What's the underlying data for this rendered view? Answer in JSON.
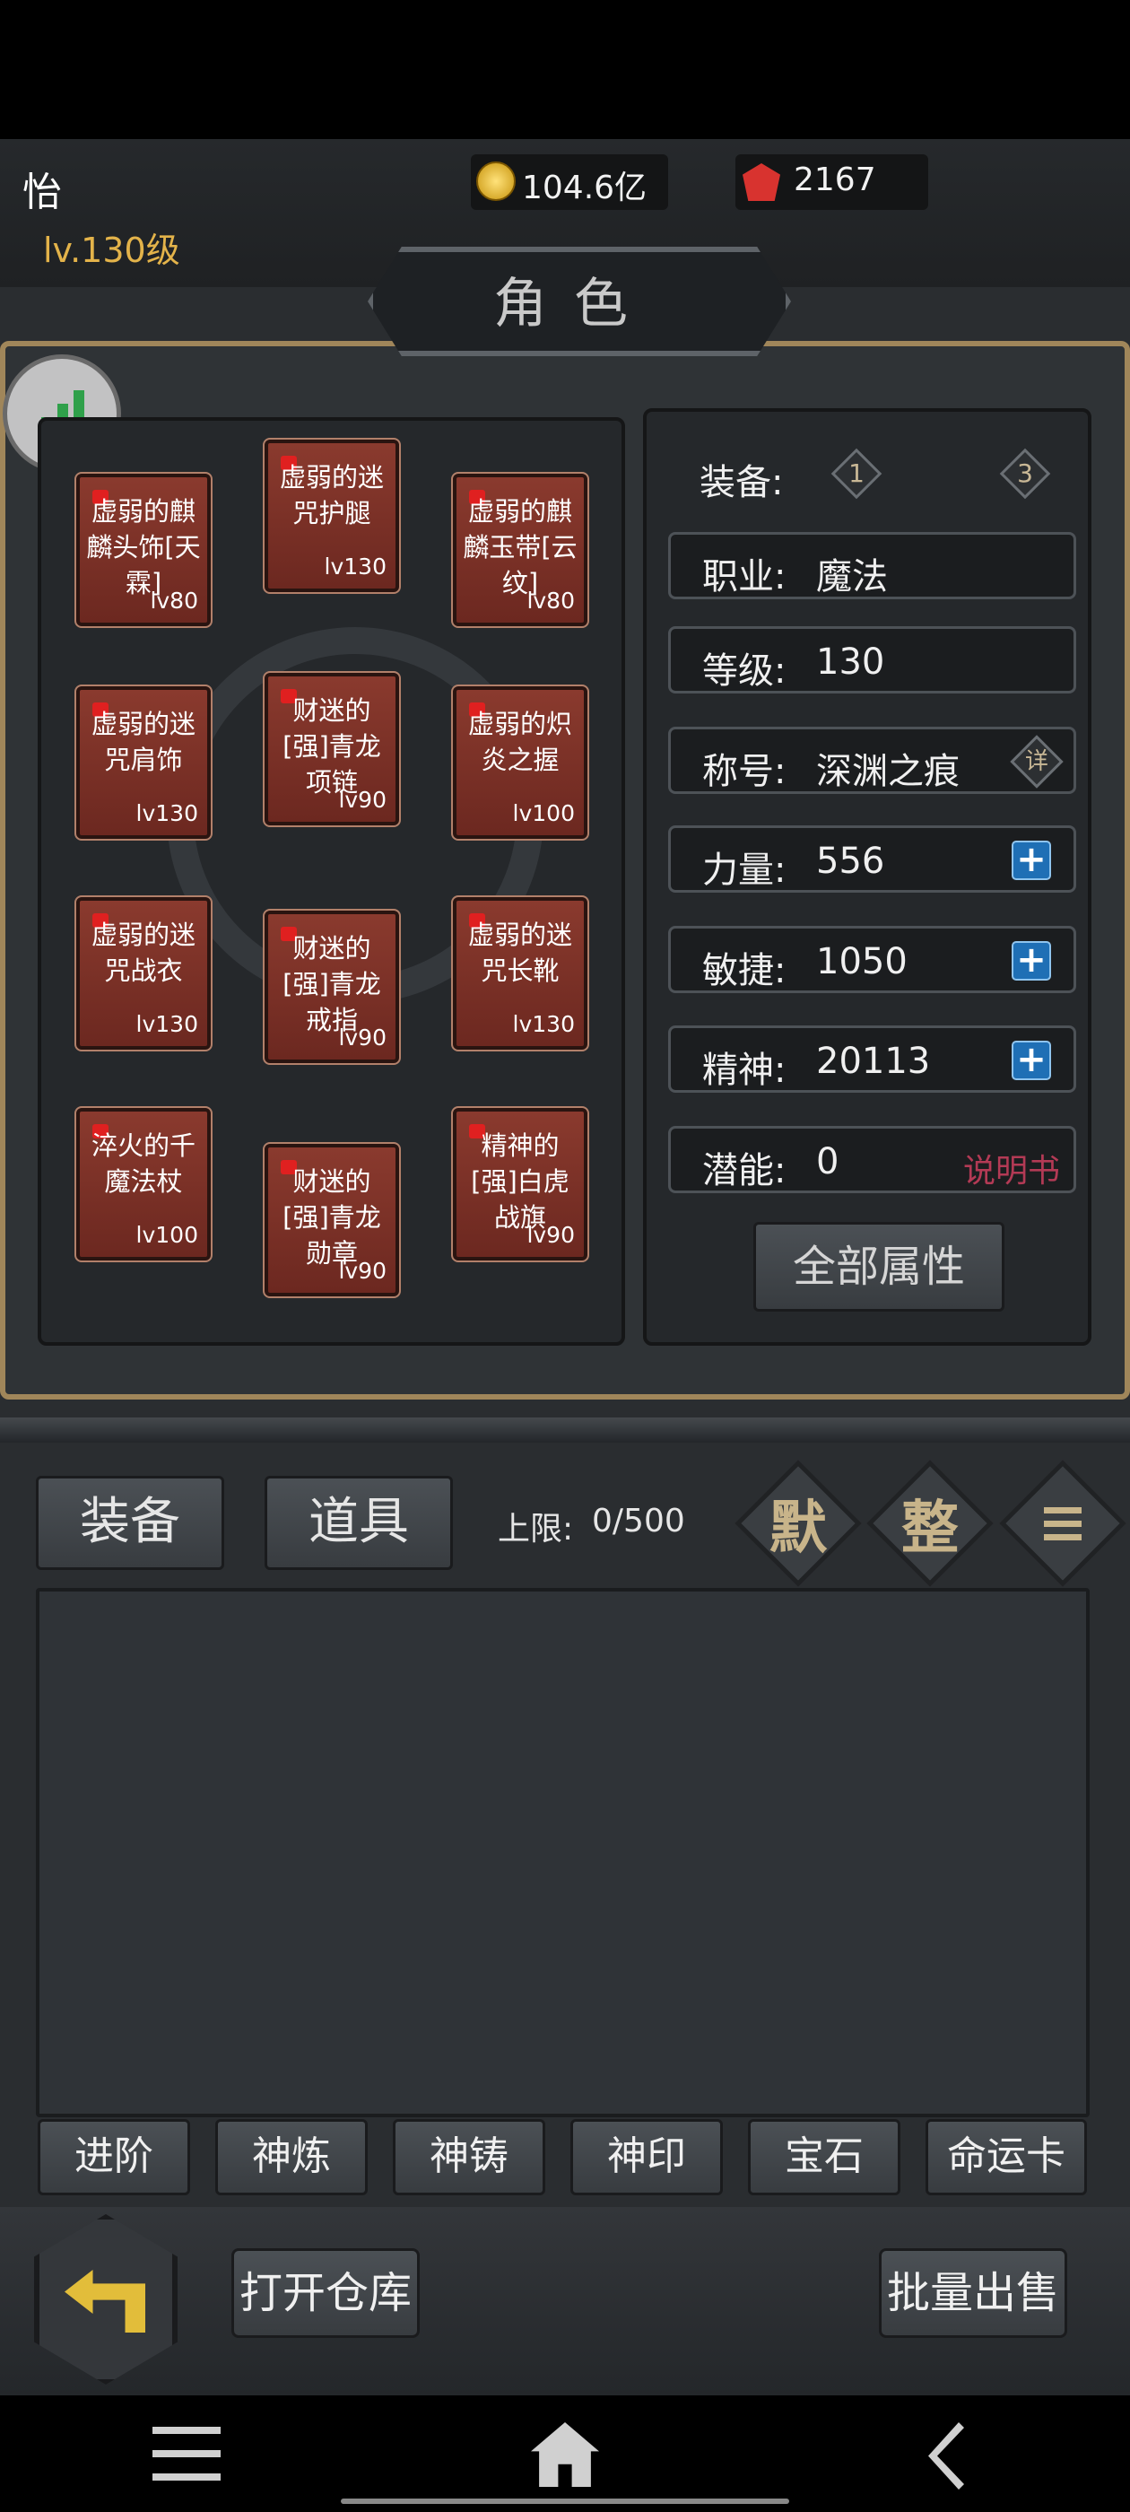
{
  "header": {
    "player_name": "怡",
    "player_level": "lv.130级",
    "gold": "104.6亿",
    "gems": "2167"
  },
  "title": "角色",
  "equipment_slots": [
    {
      "name": "虚弱的麒麟头饰[天霖]",
      "level": "lv80"
    },
    {
      "name": "虚弱的迷咒护腿",
      "level": "lv130"
    },
    {
      "name": "虚弱的麒麟玉带[云纹]",
      "level": "lv80"
    },
    {
      "name": "虚弱的迷咒肩饰",
      "level": "lv130"
    },
    {
      "name": "财迷的[强]青龙项链",
      "level": "lv90"
    },
    {
      "name": "虚弱的炽炎之握",
      "level": "lv100"
    },
    {
      "name": "虚弱的迷咒战衣",
      "level": "lv130"
    },
    {
      "name": "财迷的[强]青龙戒指",
      "level": "lv90"
    },
    {
      "name": "虚弱的迷咒长靴",
      "level": "lv130"
    },
    {
      "name": "淬火的千魔法杖",
      "level": "lv100"
    },
    {
      "name": "财迷的[强]青龙勋章",
      "level": "lv90"
    },
    {
      "name": "精神的[强]白虎战旗",
      "level": "lv90"
    }
  ],
  "stats": {
    "equip_label": "装备:",
    "equip_set_1": "1",
    "equip_set_3": "3",
    "job_label": "职业:",
    "job_value": "魔法",
    "level_label": "等级:",
    "level_value": "130",
    "title_label": "称号:",
    "title_value": "深渊之痕",
    "title_detail": "详",
    "str_label": "力量:",
    "str_value": "556",
    "agi_label": "敏捷:",
    "agi_value": "1050",
    "spi_label": "精神:",
    "spi_value": "20113",
    "pot_label": "潜能:",
    "pot_value": "0",
    "manual_link": "说明书",
    "all_attr_button": "全部属性",
    "plus_symbol": "+"
  },
  "inventory": {
    "tab_equip": "装备",
    "tab_items": "道具",
    "capacity_label": "上限:",
    "capacity_value": "0/500",
    "btn_default": "默",
    "btn_sort": "整"
  },
  "functions": [
    "进阶",
    "神炼",
    "神铸",
    "神印",
    "宝石",
    "命运卡"
  ],
  "bottom": {
    "open_warehouse": "打开仓库",
    "batch_sell": "批量出售"
  },
  "colors": {
    "accent_gold": "#a0865a",
    "equip_red": "#7c3024",
    "plus_blue": "#1f6fb5",
    "manual_pink": "#b33a55"
  }
}
